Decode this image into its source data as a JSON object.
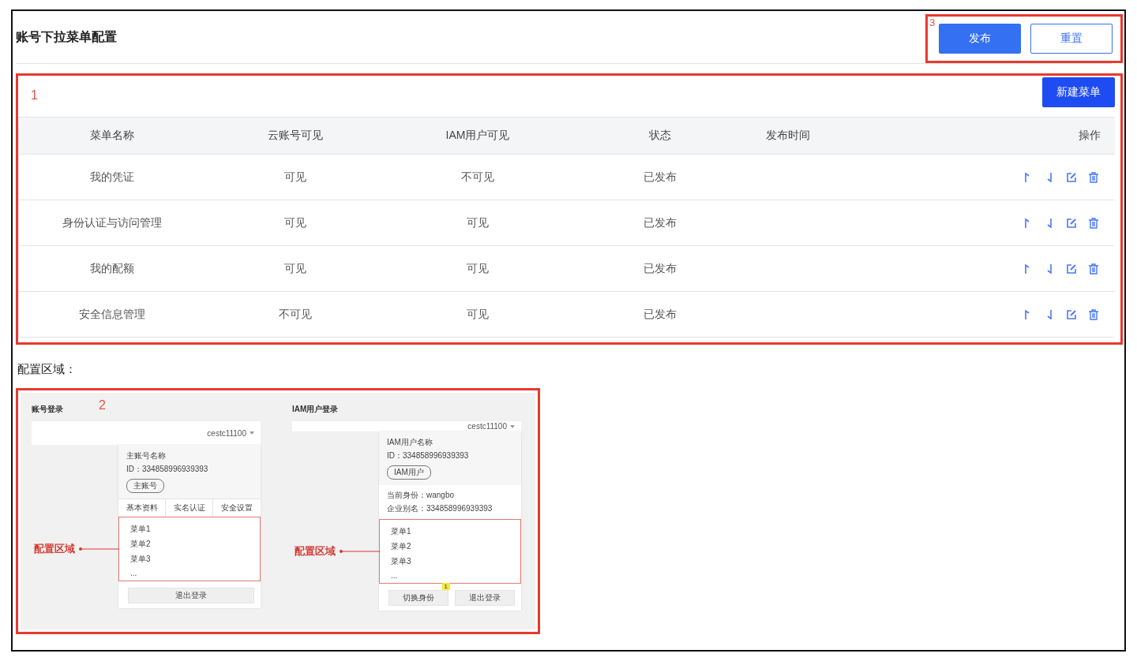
{
  "page": {
    "title": "账号下拉菜单配置"
  },
  "header": {
    "marker": "3",
    "buttons": [
      {
        "label": "发布",
        "kind": "primary"
      },
      {
        "label": "重置",
        "kind": "outline"
      }
    ]
  },
  "table_section": {
    "marker": "1",
    "new_button": "新建菜单",
    "columns": [
      "菜单名称",
      "云账号可见",
      "IAM用户可见",
      "状态",
      "发布时间",
      "操作"
    ],
    "rows": [
      {
        "name": "我的凭证",
        "cloud_visible": "可见",
        "iam_visible": "不可见",
        "status": "已发布"
      },
      {
        "name": "身份认证与访问管理",
        "cloud_visible": "可见",
        "iam_visible": "可见",
        "status": "已发布"
      },
      {
        "name": "我的配额",
        "cloud_visible": "可见",
        "iam_visible": "可见",
        "status": "已发布"
      },
      {
        "name": "安全信息管理",
        "cloud_visible": "不可见",
        "iam_visible": "可见",
        "status": "已发布"
      }
    ]
  },
  "config_label": "配置区域：",
  "preview": {
    "marker": "2",
    "panels": [
      {
        "title": "账号登录",
        "account": "cestc11100",
        "user_name": "主账号名称",
        "id": "ID：334858996939393",
        "tag": "主账号",
        "tabs": [
          "基本资料",
          "实名认证",
          "安全设置"
        ],
        "callout": "配置区域",
        "menu_items": [
          "菜单1",
          "菜单2",
          "菜单3",
          "..."
        ],
        "buttons": [
          {
            "label": "退出登录"
          }
        ]
      },
      {
        "title": "IAM用户登录",
        "account": "cestc11100",
        "user_name": "IAM用户名称",
        "id": "ID：334858996939393",
        "tag": "IAM用户",
        "info": [
          "当前身份：wangbo",
          "企业别名：334858996939393"
        ],
        "callout": "配置区域",
        "menu_items": [
          "菜单1",
          "菜单2",
          "菜单3",
          "..."
        ],
        "buttons": [
          {
            "label": "切换身份",
            "badge": "1"
          },
          {
            "label": "退出登录"
          }
        ]
      }
    ]
  }
}
